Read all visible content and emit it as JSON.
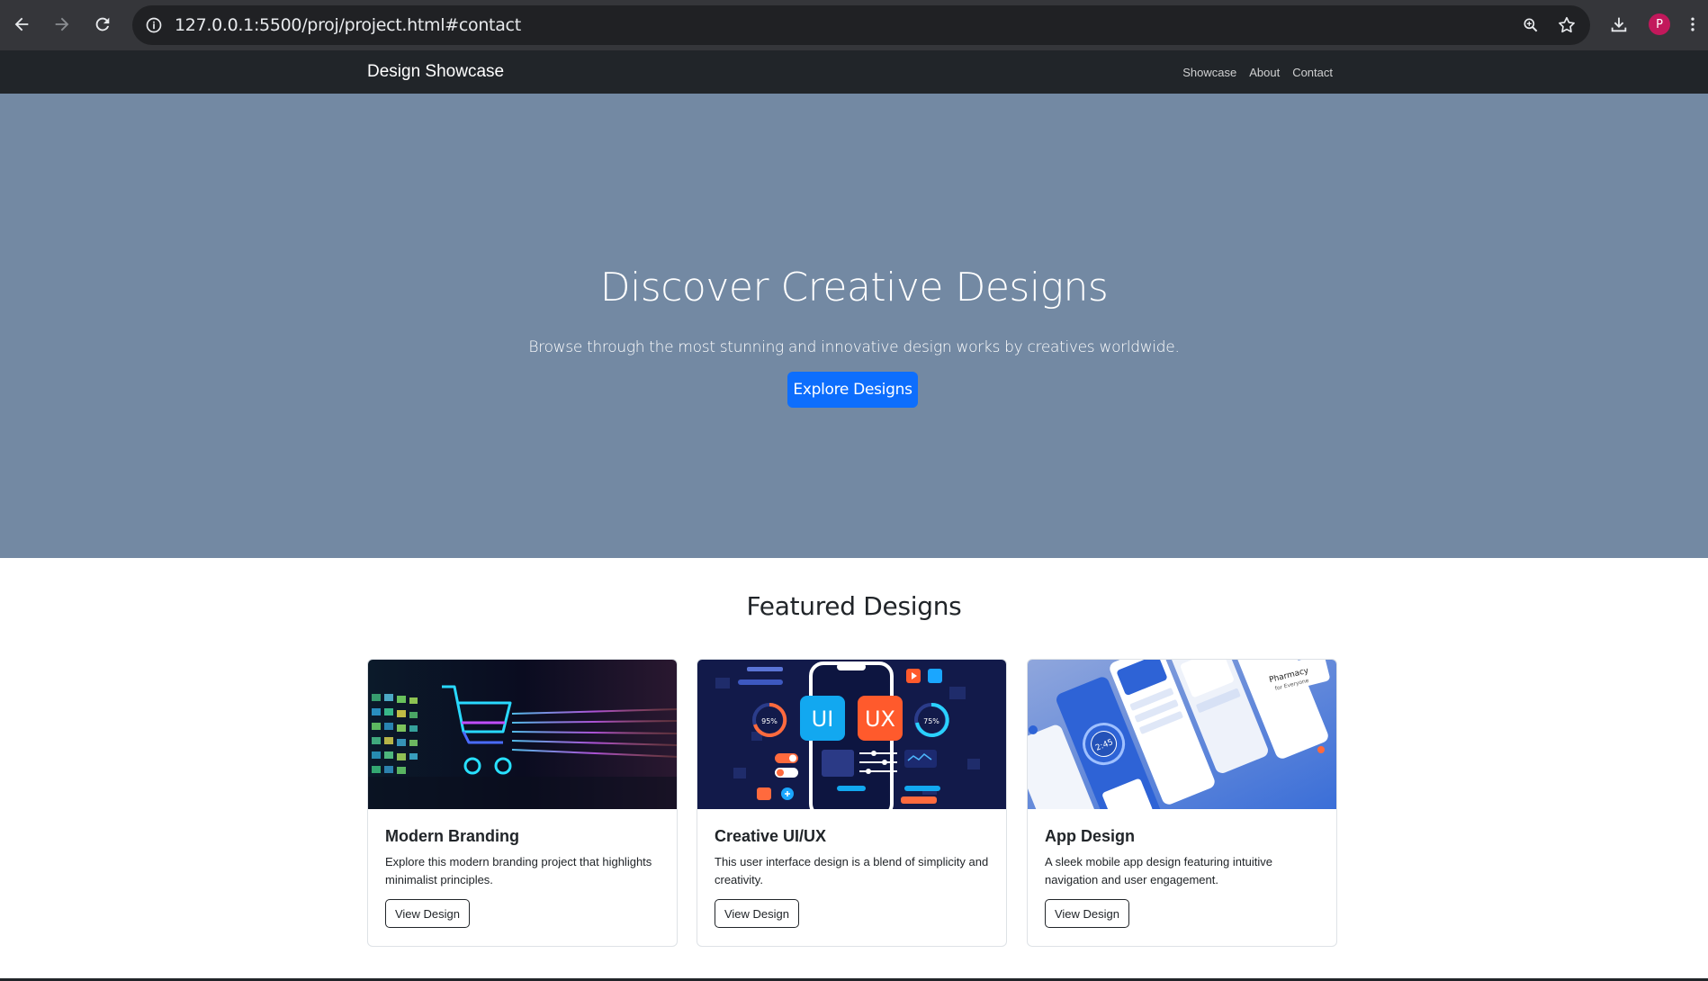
{
  "browser": {
    "url": "127.0.0.1:5500/proj/project.html#contact",
    "profile_initial": "P",
    "icons": [
      "back-icon",
      "forward-icon",
      "reload-icon",
      "info-icon",
      "zoom-icon",
      "bookmark-star-icon",
      "download-icon",
      "menu-icon"
    ]
  },
  "navbar": {
    "brand": "Design Showcase",
    "links": [
      "Showcase",
      "About",
      "Contact"
    ]
  },
  "hero": {
    "title": "Discover Creative Designs",
    "subtitle": "Browse through the most stunning and innovative design works by creatives worldwide.",
    "cta": "Explore Designs"
  },
  "featured": {
    "title": "Featured Designs",
    "cards": [
      {
        "title": "Modern Branding",
        "text": "Explore this modern branding project that highlights minimalist principles.",
        "button": "View Design"
      },
      {
        "title": "Creative UI/UX",
        "text": "This user interface design is a blend of simplicity and creativity.",
        "button": "View Design",
        "image_labels": [
          "UI",
          "UX",
          "95%",
          "75%"
        ]
      },
      {
        "title": "App Design",
        "text": "A sleek mobile app design featuring intuitive navigation and user engagement.",
        "button": "View Design",
        "image_labels": [
          "2:45",
          "Pharmacy",
          "for Everyone"
        ]
      }
    ]
  },
  "colors": {
    "chrome_bg": "#35363a",
    "omnibox_bg": "#202124",
    "navbar_bg": "#212529",
    "hero_bg": "#7389a3",
    "primary": "#0d6efd",
    "avatar": "#c2185b"
  }
}
